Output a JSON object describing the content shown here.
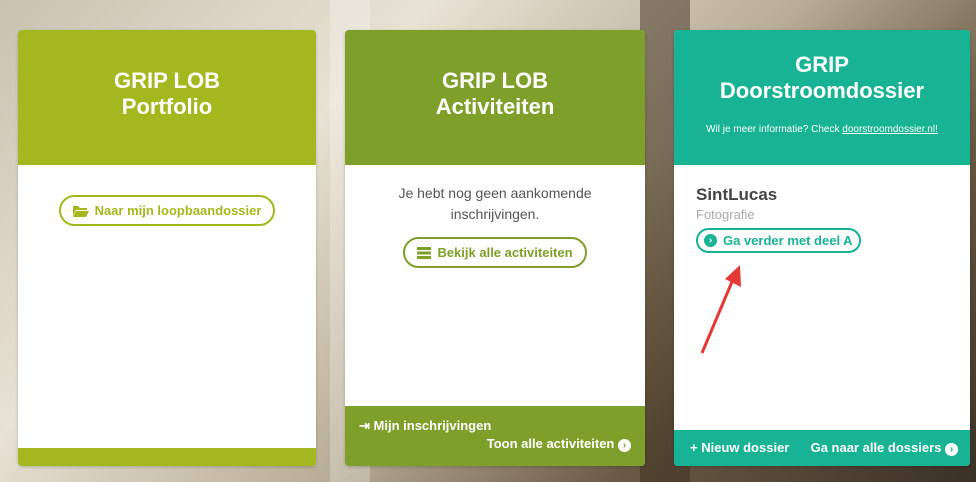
{
  "colors": {
    "portfolio_green": "#a3b81f",
    "activiteiten_green": "#7ea02a",
    "doorstroom_teal": "#17b394",
    "arrow_red": "#e53935"
  },
  "cards": {
    "portfolio": {
      "title_line1": "GRIP LOB",
      "title_line2": "Portfolio",
      "button_label": "Naar mijn loopbaandossier",
      "button_icon": "folder-open-icon"
    },
    "activiteiten": {
      "title_line1": "GRIP LOB",
      "title_line2": "Activiteiten",
      "empty_text": "Je hebt nog geen aankomende inschrijvingen.",
      "button_label": "Bekijk alle activiteiten",
      "button_icon": "list-icon",
      "footer_link1": "Mijn inschrijvingen",
      "footer_link2": "Toon alle activiteiten"
    },
    "doorstroom": {
      "title_line1": "GRIP",
      "title_line2": "Doorstroomdossier",
      "info_text": "Wil je meer informatie? Check ",
      "info_link": "doorstroomdossier.nl!",
      "school": "SintLucas",
      "program": "Fotografie",
      "button_label": "Ga verder met deel A",
      "footer_link1": "Nieuw dossier",
      "footer_link2": "Ga naar alle dossiers"
    }
  }
}
